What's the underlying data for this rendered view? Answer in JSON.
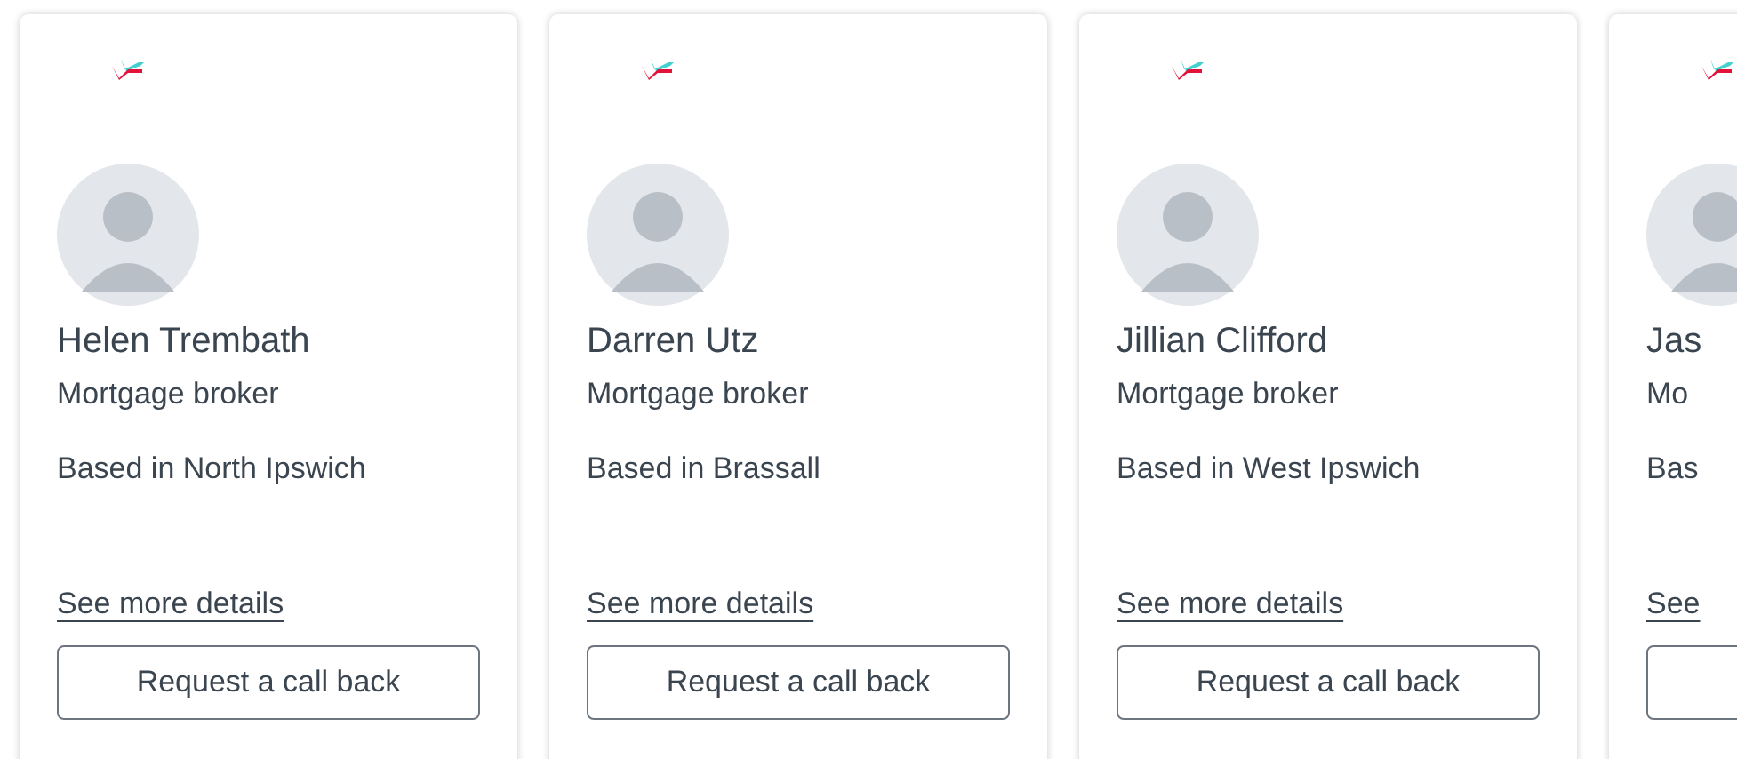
{
  "cards": [
    {
      "name": "Helen Trembath",
      "role": "Mortgage broker",
      "location": "Based in North Ipswich",
      "details_link": "See more details",
      "button": "Request a call back"
    },
    {
      "name": "Darren Utz",
      "role": "Mortgage broker",
      "location": "Based in Brassall",
      "details_link": "See more details",
      "button": "Request a call back"
    },
    {
      "name": "Jillian Clifford",
      "role": "Mortgage broker",
      "location": "Based in West Ipswich",
      "details_link": "See more details",
      "button": "Request a call back"
    },
    {
      "name": "Jas",
      "role": "Mo",
      "location": "Bas",
      "details_link": "See"
    }
  ]
}
